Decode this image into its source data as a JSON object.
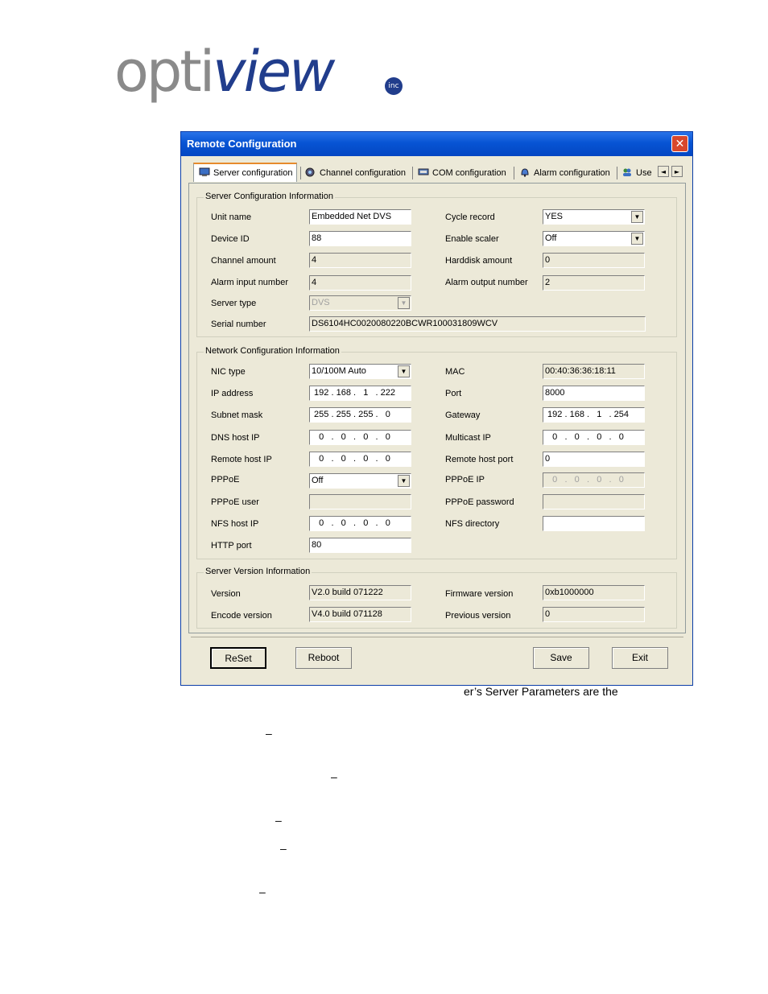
{
  "logo": {
    "opti": "opti",
    "view": "view",
    "seal": "inc"
  },
  "window": {
    "title": "Remote Configuration",
    "close": "✕"
  },
  "tabs": [
    {
      "label": "Server configuration",
      "icon": "monitor-icon"
    },
    {
      "label": "Channel configuration",
      "icon": "camera-icon"
    },
    {
      "label": "COM configuration",
      "icon": "com-port-icon"
    },
    {
      "label": "Alarm configuration",
      "icon": "bell-icon"
    },
    {
      "label": "Use",
      "icon": "users-icon"
    }
  ],
  "tab_scroll": {
    "left": "◄",
    "right": "►"
  },
  "server_info": {
    "title": "Server Configuration Information",
    "unit_name": {
      "label": "Unit name",
      "value": "Embedded Net DVS"
    },
    "device_id": {
      "label": "Device ID",
      "value": "88"
    },
    "channel_amount": {
      "label": "Channel amount",
      "value": "4"
    },
    "alarm_input": {
      "label": "Alarm input number",
      "value": "4"
    },
    "server_type": {
      "label": "Server type",
      "value": "DVS"
    },
    "serial": {
      "label": "Serial number",
      "value": "DS6104HC0020080220BCWR100031809WCV"
    },
    "cycle_record": {
      "label": "Cycle record",
      "value": "YES"
    },
    "enable_scaler": {
      "label": "Enable scaler",
      "value": "Off"
    },
    "harddisk": {
      "label": "Harddisk amount",
      "value": "0"
    },
    "alarm_output": {
      "label": "Alarm output number",
      "value": "2"
    }
  },
  "network_info": {
    "title": "Network Configuration Information",
    "nic_type": {
      "label": "NIC type",
      "value": "10/100M Auto"
    },
    "ip": {
      "label": "IP address",
      "value": " 192 . 168 .   1   . 222"
    },
    "subnet": {
      "label": "Subnet mask",
      "value": " 255 . 255 . 255 .   0"
    },
    "dns": {
      "label": "DNS host IP",
      "value": "   0   .   0   .   0   .   0"
    },
    "remote_host": {
      "label": "Remote host IP",
      "value": "   0   .   0   .   0   .   0"
    },
    "pppoe": {
      "label": "PPPoE",
      "value": "Off"
    },
    "pppoe_user": {
      "label": "PPPoE user",
      "value": ""
    },
    "nfs_host": {
      "label": "NFS host IP",
      "value": "   0   .   0   .   0   .   0"
    },
    "http_port": {
      "label": "HTTP port",
      "value": "80"
    },
    "mac": {
      "label": "MAC",
      "value": "00:40:36:36:18:11"
    },
    "port": {
      "label": "Port",
      "value": "8000"
    },
    "gateway": {
      "label": "Gateway",
      "value": " 192 . 168 .   1   . 254"
    },
    "multicast": {
      "label": "Multicast IP",
      "value": "   0   .   0   .   0   .   0"
    },
    "remote_port": {
      "label": "Remote host port",
      "value": "0"
    },
    "pppoe_ip": {
      "label": "PPPoE IP",
      "value": "   0   .   0   .   0   .   0"
    },
    "pppoe_password": {
      "label": "PPPoE password",
      "value": ""
    },
    "nfs_dir": {
      "label": "NFS directory",
      "value": ""
    }
  },
  "version_info": {
    "title": "Server Version Information",
    "version": {
      "label": "Version",
      "value": "V2.0 build 071222"
    },
    "encode": {
      "label": "Encode version",
      "value": "V4.0 build 071128"
    },
    "firmware": {
      "label": "Firmware version",
      "value": "0xb1000000"
    },
    "previous": {
      "label": "Previous version",
      "value": "0"
    }
  },
  "buttons": {
    "reset": "ReSet",
    "reboot": "Reboot",
    "save": "Save",
    "exit": "Exit"
  },
  "caption": "er’s Server Parameters are the",
  "dash": "–",
  "combo_arrow": "▼"
}
